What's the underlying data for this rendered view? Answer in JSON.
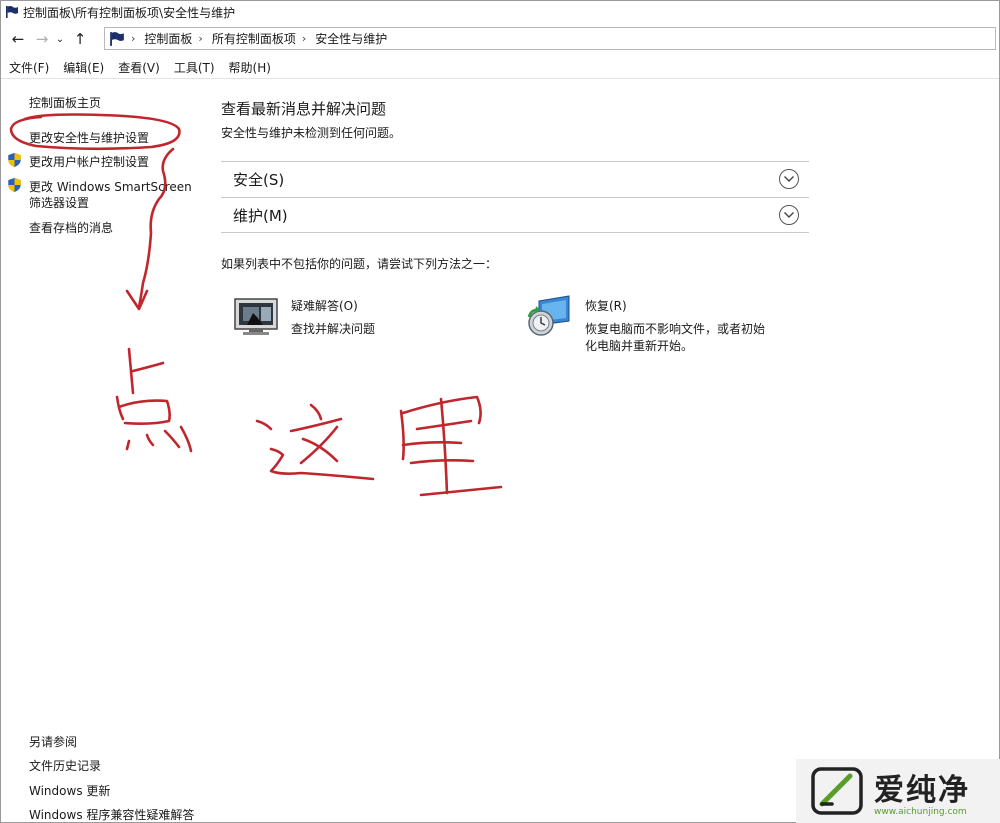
{
  "window": {
    "title": "控制面板\\所有控制面板项\\安全性与维护",
    "title_icon": "flag-icon"
  },
  "nav": {
    "back": "←",
    "forward": "→",
    "recent": "⌄",
    "up": "↑",
    "separator": "›",
    "breadcrumbs": [
      "控制面板",
      "所有控制面板项",
      "安全性与维护"
    ]
  },
  "menu": {
    "items": [
      "文件(F)",
      "编辑(E)",
      "查看(V)",
      "工具(T)",
      "帮助(H)"
    ]
  },
  "left_pane": {
    "links": [
      {
        "label": "控制面板主页",
        "icon": ""
      },
      {
        "label": "更改安全性与维护设置",
        "icon": ""
      },
      {
        "label": "更改用户帐户控制设置",
        "icon": "uac-shield-icon"
      },
      {
        "label": "更改 Windows SmartScreen",
        "label2": "筛选器设置",
        "icon": "uac-shield-icon"
      },
      {
        "label": "查看存档的消息",
        "icon": ""
      }
    ],
    "see_also": {
      "heading": "另请参阅",
      "links": [
        "文件历史记录",
        "Windows 更新",
        "Windows 程序兼容性疑难解答"
      ]
    }
  },
  "main": {
    "title": "查看最新消息并解决问题",
    "subtitle": "安全性与维护未检测到任何问题。",
    "sections": [
      {
        "label": "安全(S)",
        "icon": "chevron-down-circle-icon"
      },
      {
        "label": "维护(M)",
        "icon": "chevron-down-circle-icon"
      }
    ],
    "hint": "如果列表中不包括你的问题，请尝试下列方法之一：",
    "tools": [
      {
        "name": "疑难解答(O)",
        "desc": "查找并解决问题",
        "icon": "troubleshoot-monitor-icon"
      },
      {
        "name": "恢复(R)",
        "desc1": "恢复电脑而不影响文件，或者初始",
        "desc2": "化电脑并重新开始。",
        "icon": "recovery-monitor-icon"
      }
    ]
  },
  "annotation": {
    "handwriting": "点这里",
    "color": "#c0272d"
  },
  "watermark": {
    "brand": "爱纯净",
    "url": "www.aichunjing.com",
    "logo": "aichunjing-logo-icon"
  },
  "colors": {
    "text": "#1a1a1a",
    "border": "#c8c8c8",
    "annotation_red": "#c0272d",
    "uac_blue": "#2a5fbf",
    "uac_yellow": "#f2c200"
  }
}
